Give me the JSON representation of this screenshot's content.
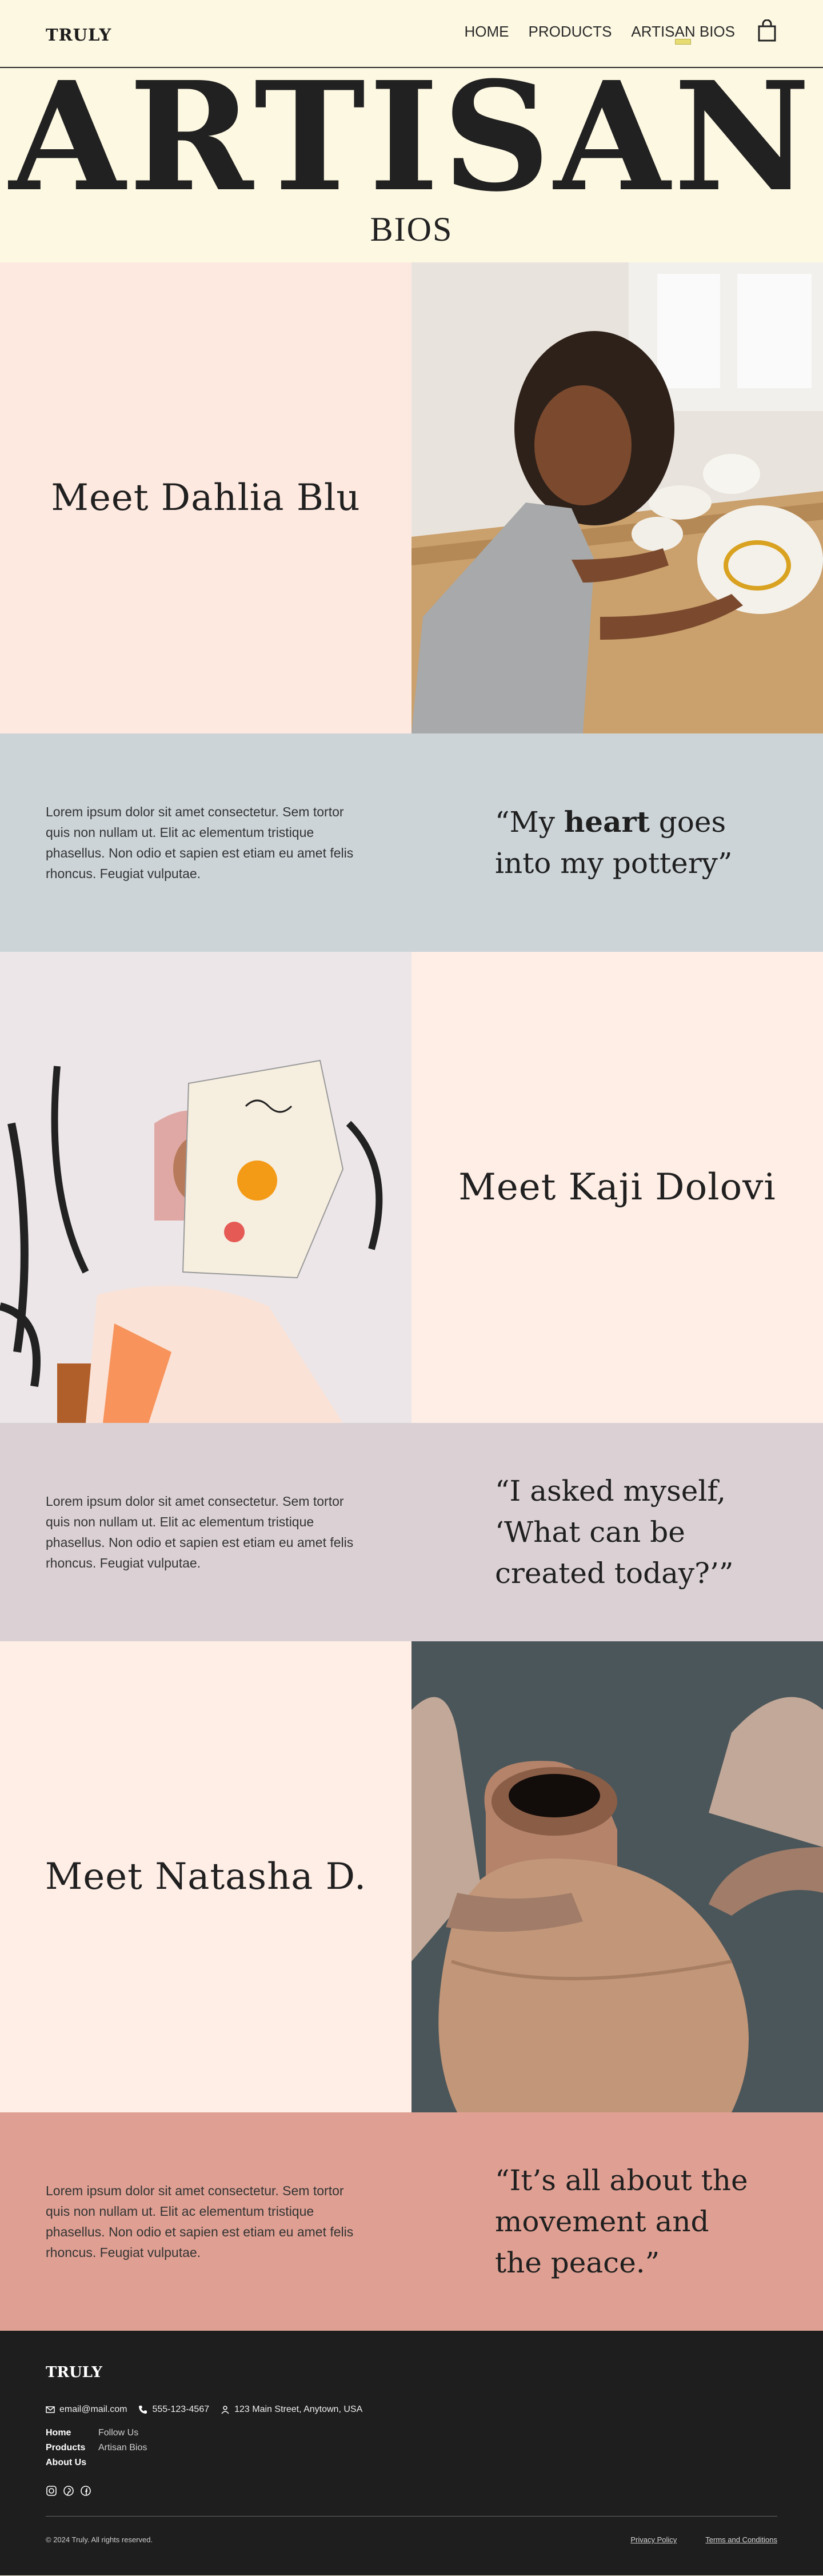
{
  "header": {
    "brand": "TRULY",
    "nav": [
      "HOME",
      "PRODUCTS",
      "ARTISAN BIOS"
    ],
    "active_nav": "ARTISAN BIOS",
    "cart_icon": "shopping-bag-icon"
  },
  "hero": {
    "title": "ARTISAN",
    "subtitle": "BIOS"
  },
  "profiles": [
    {
      "name": "Meet Dahlia Blu",
      "quote_pre": "“My ",
      "quote_bold": "heart",
      "quote_post": " goes into my pottery”",
      "bio": "Lorem ipsum dolor sit amet consectetur. Sem tortor quis non nullam ut. Elit ac elementum tristique phasellus. Non odio et sapien est etiam eu amet felis rhoncus. Feugiat vulputae.",
      "name_bg": "#fee9e0",
      "quote_bg": "#ccd4d8"
    },
    {
      "name": "Meet Kaji Dolovi",
      "quote_pre": "“I asked myself, ‘What can be created today?’”",
      "quote_bold": "",
      "quote_post": "",
      "bio": "Lorem ipsum dolor sit amet consectetur. Sem tortor quis non nullam ut. Elit ac elementum tristique phasellus. Non odio et sapien est etiam eu amet felis rhoncus. Feugiat vulputae.",
      "name_bg": "#ffeee6",
      "quote_bg": "#dbd1d5"
    },
    {
      "name": "Meet Natasha D.",
      "quote_pre": "“It’s all about the movement and the peace.”",
      "quote_bold": "",
      "quote_post": "",
      "bio": "Lorem ipsum dolor sit amet consectetur. Sem tortor quis non nullam ut. Elit ac elementum tristique phasellus. Non odio et sapien est etiam eu amet felis rhoncus. Feugiat vulputae.",
      "name_bg": "#ffeee6",
      "quote_bg": "#dfa093"
    }
  ],
  "footer": {
    "brand": "TRULY",
    "email": "email@mail.com",
    "phone": "555-123-4567",
    "address": "123 Main Street, Anytown, USA",
    "links": {
      "home": "Home",
      "follow": "Follow Us",
      "products": "Products",
      "artisan": "Artisan Bios",
      "about": "About Us"
    },
    "social_icons": [
      "instagram-icon",
      "pinterest-icon",
      "facebook-icon"
    ],
    "copyright": "© 2024 Truly. All rights reserved.",
    "privacy": "Privacy Policy",
    "terms": "Terms and Conditions"
  }
}
